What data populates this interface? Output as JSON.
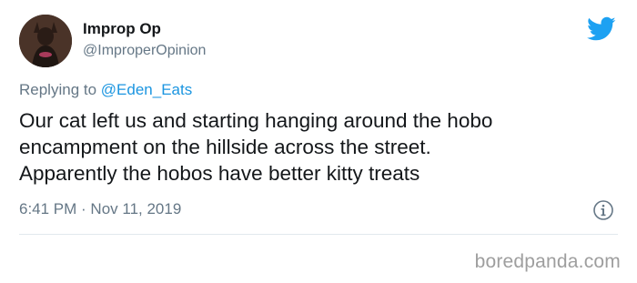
{
  "tweet": {
    "display_name": "Improp Op",
    "handle": "@ImproperOpinion",
    "replying_prefix": "Replying to ",
    "replying_to": "@Eden_Eats",
    "text_lines": [
      "Our cat left us and starting hanging around the hobo",
      "encampment on the hillside across the street.",
      "Apparently the hobos have better kitty treats"
    ],
    "timestamp": "6:41 PM · Nov 11, 2019"
  },
  "icons": {
    "brand": "twitter-bird-icon",
    "info": "info-icon"
  },
  "colors": {
    "brand_blue": "#1da1f2",
    "link_blue": "#1b95e0",
    "secondary_text": "#657786",
    "primary_text": "#14171a",
    "divider": "#e1e8ed"
  },
  "watermark": {
    "text": "boredpanda.com"
  }
}
